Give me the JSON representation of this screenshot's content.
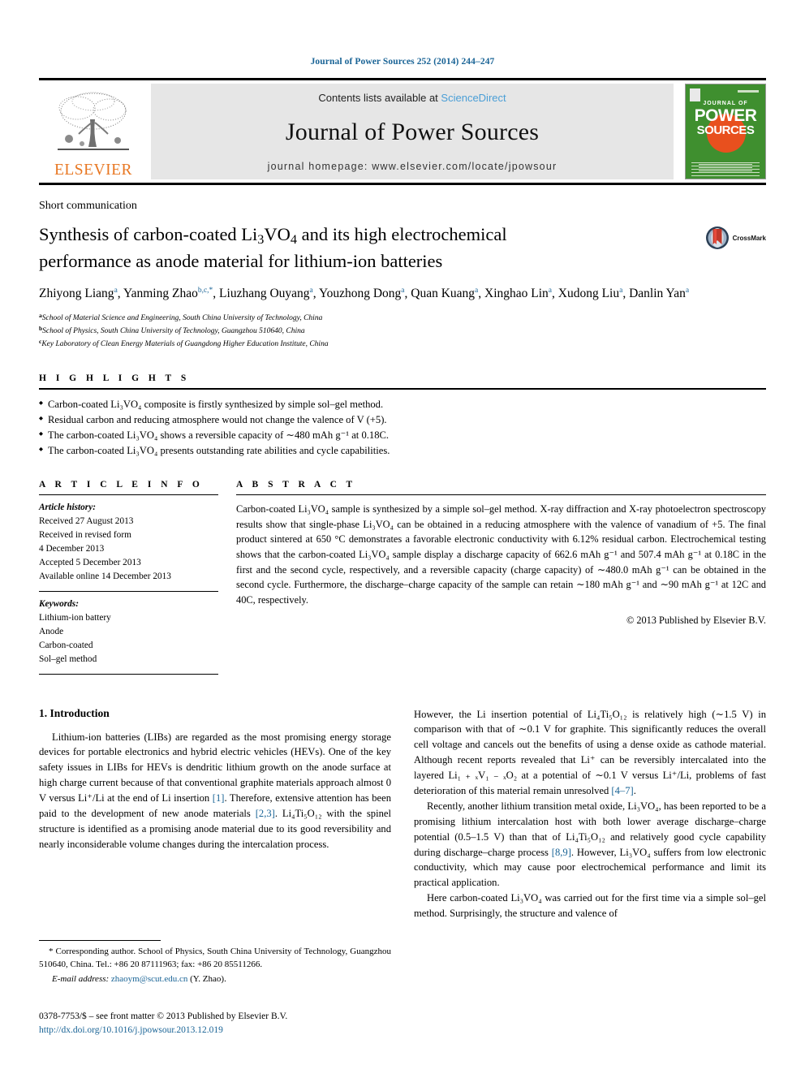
{
  "running_head": "Journal of Power Sources 252 (2014) 244–247",
  "masthead": {
    "contents_prefix": "Contents lists available at",
    "sciencedirect": "ScienceDirect",
    "journal_name": "Journal of Power Sources",
    "homepage": "journal homepage: www.elsevier.com/locate/jpowsour",
    "publisher_word": "ELSEVIER",
    "publisher_logo_name": "elsevier-tree-logo",
    "cover": {
      "journal_of": "JOURNAL OF",
      "power": "POWER",
      "sources": "SOURCES"
    },
    "colors": {
      "link_blue": "#1a6496",
      "sciencedirect_blue": "#4a9ed6",
      "elsevier_orange": "#E87722",
      "cover_green": "#3f8f2f",
      "cover_orange": "#E8501E",
      "band_gray": "#e6e6e6"
    }
  },
  "article": {
    "doctype": "Short communication",
    "title_line1_a": "Synthesis of carbon-coated Li",
    "title_sub1": "3",
    "title_line1_b": "VO",
    "title_sub2": "4",
    "title_line1_c": " and its high electrochemical",
    "title_line2": "performance as anode material for lithium-ion batteries",
    "crossmark_label": "CrossMark",
    "authors": [
      {
        "name": "Zhiyong Liang",
        "mark": "a",
        "sep": ", "
      },
      {
        "name": "Yanming Zhao",
        "mark": "b,c,*",
        "sep": ", "
      },
      {
        "name": "Liuzhang Ouyang",
        "mark": "a",
        "sep": ", "
      },
      {
        "name": "Youzhong Dong",
        "mark": "a",
        "sep": ", "
      },
      {
        "name": "Quan Kuang",
        "mark": "a",
        "sep": ", "
      },
      {
        "name": "Xinghao Lin",
        "mark": "a",
        "sep": ", "
      },
      {
        "name": "Xudong Liu",
        "mark": "a",
        "sep": ", "
      },
      {
        "name": "Danlin Yan",
        "mark": "a",
        "sep": ""
      }
    ],
    "affiliations": [
      {
        "mark": "a",
        "text": "School of Material Science and Engineering, South China University of Technology, China"
      },
      {
        "mark": "b",
        "text": "School of Physics, South China University of Technology, Guangzhou 510640, China"
      },
      {
        "mark": "c",
        "text": "Key Laboratory of Clean Energy Materials of Guangdong Higher Education Institute, China"
      }
    ]
  },
  "highlights": {
    "heading": "H I G H L I G H T S",
    "items": [
      "Carbon-coated Li₃VO₄ composite is firstly synthesized by simple sol–gel method.",
      "Residual carbon and reducing atmosphere would not change the valence of V (+5).",
      "The carbon-coated Li₃VO₄ shows a reversible capacity of ∼480 mAh g⁻¹ at 0.18C.",
      "The carbon-coated Li₃VO₄ presents outstanding rate abilities and cycle capabilities."
    ]
  },
  "article_info": {
    "heading": "A R T I C L E   I N F O",
    "history_label": "Article history:",
    "history": [
      "Received 27 August 2013",
      "Received in revised form",
      "4 December 2013",
      "Accepted 5 December 2013",
      "Available online 14 December 2013"
    ],
    "keywords_label": "Keywords:",
    "keywords": [
      "Lithium-ion battery",
      "Anode",
      "Carbon-coated",
      "Sol–gel method"
    ]
  },
  "abstract": {
    "heading": "A B S T R A C T",
    "text": "Carbon-coated Li₃VO₄ sample is synthesized by a simple sol–gel method. X-ray diffraction and X-ray photoelectron spectroscopy results show that single-phase Li₃VO₄ can be obtained in a reducing atmosphere with the valence of vanadium of +5. The final product sintered at 650 °C demonstrates a favorable electronic conductivity with 6.12% residual carbon. Electrochemical testing shows that the carbon-coated Li₃VO₄ sample display a discharge capacity of 662.6 mAh g⁻¹ and 507.4 mAh g⁻¹ at 0.18C in the first and the second cycle, respectively, and a reversible capacity (charge capacity) of ∼480.0 mAh g⁻¹ can be obtained in the second cycle. Furthermore, the discharge–charge capacity of the sample can retain ∼180 mAh g⁻¹ and ∼90 mAh g⁻¹ at 12C and 40C, respectively.",
    "copyright": "© 2013 Published by Elsevier B.V."
  },
  "body": {
    "section_heading": "1. Introduction",
    "left_p1_a": "Lithium-ion batteries (LIBs) are regarded as the most promising energy storage devices for portable electronics and hybrid electric vehicles (HEVs). One of the key safety issues in LIBs for HEVs is dendritic lithium growth on the anode surface at high charge current because of that conventional graphite materials approach almost 0 V versus Li⁺/Li at the end of Li insertion ",
    "left_ref1": "[1]",
    "left_p1_b": ". Therefore, extensive attention has been paid to the development of new anode materials ",
    "left_ref2": "[2,3]",
    "left_p1_c": ". Li₄Ti₅O₁₂ with the spinel structure is identified as a promising anode material due to its good reversibility and nearly inconsiderable volume changes during the intercalation process.",
    "right_p1_a": "However, the Li insertion potential of Li₄Ti₅O₁₂ is relatively high (∼1.5 V) in comparison with that of ∼0.1 V for graphite. This significantly reduces the overall cell voltage and cancels out the benefits of using a dense oxide as cathode material. Although recent reports revealed that Li⁺ can be reversibly intercalated into the layered Li₁ ₊ ₓV₁ ₋ ₓO₂ at a potential of ∼0.1 V versus Li⁺/Li, problems of fast deterioration of this material remain unresolved ",
    "right_ref1": "[4–7]",
    "right_p1_b": ".",
    "right_p2_a": "Recently, another lithium transition metal oxide, Li₃VO₄, has been reported to be a promising lithium intercalation host with both lower average discharge–charge potential (0.5–1.5 V) than that of Li₄Ti₅O₁₂ and relatively good cycle capability during discharge–charge process ",
    "right_ref2": "[8,9]",
    "right_p2_b": ". However, Li₃VO₄ suffers from low electronic conductivity, which may cause poor electrochemical performance and limit its practical application.",
    "right_p3": "Here carbon-coated Li₃VO₄ was carried out for the first time via a simple sol–gel method. Surprisingly, the structure and valence of"
  },
  "footnotes": {
    "corresponding": "* Corresponding author. School of Physics, South China University of Technology, Guangzhou 510640, China. Tel.: +86 20 87111963; fax: +86 20 85511266.",
    "email_label": "E-mail address:",
    "email": "zhaoym@scut.edu.cn",
    "email_suffix": "(Y. Zhao).",
    "front_matter": "0378-7753/$ – see front matter © 2013 Published by Elsevier B.V.",
    "doi": "http://dx.doi.org/10.1016/j.jpowsour.2013.12.019"
  }
}
